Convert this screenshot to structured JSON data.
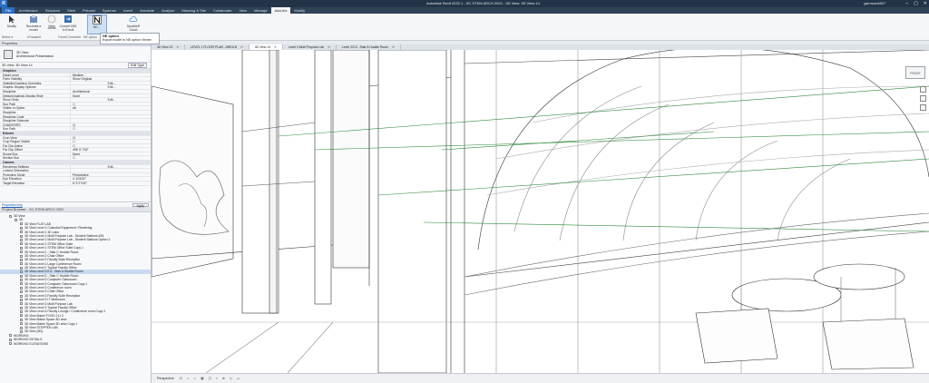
{
  "app": {
    "logo": "R",
    "title": "Autodesk Revit 2022.1 - SC STEM ARCH 2022 - 3D View: 3D View 14",
    "user": "gsimson4827"
  },
  "window": {
    "min": "–",
    "max": "▢",
    "close": "✕"
  },
  "ribbon_tabs": [
    "File",
    "Architecture",
    "Structure",
    "Steel",
    "Precast",
    "Systems",
    "Insert",
    "Annotate",
    "Analyze",
    "Massing & Site",
    "Collaborate",
    "View",
    "Manage",
    "Add-Ins",
    "Modify"
  ],
  "active_tab": "Add-Ins",
  "ribbon": {
    "buttons": [
      {
        "label": "Modify"
      },
      {
        "label": "Recreate a model"
      },
      {
        "label": "Help"
      },
      {
        "label": "About"
      },
      {
        "label": "Convert IMS to Enroll"
      },
      {
        "label": "NE ..."
      },
      {
        "label": "SpeckleR Cloud"
      }
    ],
    "panels": [
      "Select ▾",
      "eTransmit",
      "Formit Converter",
      "NE option"
    ],
    "tooltip": {
      "title": "NE option",
      "body": "Export model to NE option Viewer"
    }
  },
  "properties": {
    "header": "Properties",
    "type_title": "3D View",
    "type_sub": "Architectural Presentation",
    "view_selector": "3D View: 3D View 14",
    "edit_type": "Edit Type",
    "rows": [
      {
        "k": "Graphics",
        "v": "",
        "cat": true
      },
      {
        "k": "Detail Level",
        "v": "Medium"
      },
      {
        "k": "Parts Visibility",
        "v": "Show Original"
      },
      {
        "k": "Visibility/Graphics Overrides",
        "v": "Edit...",
        "btn": true
      },
      {
        "k": "Graphic Display Options",
        "v": "Edit...",
        "btn": true
      },
      {
        "k": "Discipline",
        "v": "Architectural"
      },
      {
        "k": "Default Analysis Display Style",
        "v": "None"
      },
      {
        "k": "Show Grids",
        "v": "Edit...",
        "btn": true
      },
      {
        "k": "Sun Path",
        "v": "☐"
      },
      {
        "k": "Visible in Option",
        "v": "All"
      },
      {
        "k": "Discipline",
        "v": ""
      },
      {
        "k": "Discipline Code",
        "v": ""
      },
      {
        "k": "Discipline Subcode",
        "v": ""
      },
      {
        "k": "CHAINTERS",
        "v": "☑"
      },
      {
        "k": "Sun Path",
        "v": "☐"
      },
      {
        "k": "Extents",
        "v": "",
        "cat": true
      },
      {
        "k": "Crop View",
        "v": "☑"
      },
      {
        "k": "Crop Region Visible",
        "v": "☐"
      },
      {
        "k": "Far Clip Active",
        "v": "☐"
      },
      {
        "k": "Far Clip Offset",
        "v": "496' 8 7/32\""
      },
      {
        "k": "Scope Box",
        "v": "None"
      },
      {
        "k": "Section Box",
        "v": "☐"
      },
      {
        "k": "Camera",
        "v": "",
        "cat": true
      },
      {
        "k": "Rendering Settings",
        "v": "Edit...",
        "btn": true
      },
      {
        "k": "Locked Orientation",
        "v": ""
      },
      {
        "k": "Projection Mode",
        "v": "Perspective"
      },
      {
        "k": "Eye Elevation",
        "v": "4' 103/32\""
      },
      {
        "k": "Target Elevation",
        "v": "6' 9 27/32\""
      }
    ],
    "help_link": "Properties help",
    "apply": "Apply"
  },
  "browser": {
    "header": "Project Browser - SC STEM ARCH 2022",
    "items": [
      {
        "label": "3D View",
        "indent": 1
      },
      {
        "label": "3D",
        "indent": 2
      },
      {
        "label": "3D View FLAT LAB",
        "indent": 3
      },
      {
        "label": "3D View Level 1 Custodial Equipment / Receiving",
        "indent": 3
      },
      {
        "label": "3D View Level 1 3D Labs",
        "indent": 3
      },
      {
        "label": "3D View Level 1 Multi Purpose Lab - Student Stations #26",
        "indent": 3
      },
      {
        "label": "3D View Level 1 Multi Purpose Lab - Student Stations Option 2",
        "indent": 3
      },
      {
        "label": "3D View Level 1 STEM Office Suite",
        "indent": 3
      },
      {
        "label": "3D View Level 1 STEM Office Suite Copy 1",
        "indent": 3
      },
      {
        "label": "3D View Level 2 - Stair C Huddle Room",
        "indent": 3
      },
      {
        "label": "3D View Level 2 Chair Office",
        "indent": 3
      },
      {
        "label": "3D View Level 2 Faculty Suite Reception",
        "indent": 3
      },
      {
        "label": "3D View Level 2 Large Conference Room",
        "indent": 3
      },
      {
        "label": "3D View Level 2 Typical Faculty Office",
        "indent": 3
      },
      {
        "label": "3D View Level 2/2 6 - Stair A Huddle Room",
        "indent": 3,
        "sel": true
      },
      {
        "label": "3D View Level 3 - Stair C Huddle Room",
        "indent": 3
      },
      {
        "label": "3D View Level 3 Computer Classroom",
        "indent": 3
      },
      {
        "label": "3D View Level 3 Computer Classroom Copy 1",
        "indent": 3
      },
      {
        "label": "3D View Level 3 Conference room",
        "indent": 3
      },
      {
        "label": "3D View Level 3 Chair Office",
        "indent": 3
      },
      {
        "label": "3D View Level 3 Faculty Suite Reception",
        "indent": 3
      },
      {
        "label": "3D View Level 3 IT Workroom",
        "indent": 3
      },
      {
        "label": "3D View Level 3 Multi Purpose Lab",
        "indent": 3
      },
      {
        "label": "3D View Level 3 Typical Faculty Office",
        "indent": 3
      },
      {
        "label": "3D View Level 4 Faculty Lounge / Conference room Copy 1",
        "indent": 3
      },
      {
        "label": "3D View Maker FOOD 2 Lt 2",
        "indent": 3
      },
      {
        "label": "3D View Maker Space 3D view",
        "indent": 3
      },
      {
        "label": "3D View Maker Space 3D view Copy 1",
        "indent": 3
      },
      {
        "label": "3D View STEPPED LAB",
        "indent": 3
      },
      {
        "label": "3D View {3D}",
        "indent": 3
      },
      {
        "label": "WORKING",
        "indent": 1
      },
      {
        "label": "WORKING DETAILS",
        "indent": 1
      },
      {
        "label": "WORKING ELEVATIONS",
        "indent": 1
      }
    ]
  },
  "view_tabs": [
    {
      "label": "3D View 13"
    },
    {
      "label": "LEVEL 1 FLOOR PLAN - AREA B"
    },
    {
      "label": "3D View 14",
      "active": true
    },
    {
      "label": "Level 3 Multi Purpose Lab"
    },
    {
      "label": "Level 2/2.6 - Stair A Huddle Room"
    }
  ],
  "viewcube": "FRONT",
  "status": {
    "mode": "Perspective",
    "icons": "⊡ ☼ ◐ ▦ ◫ ⌖ ⊕ ◇ ▭"
  }
}
